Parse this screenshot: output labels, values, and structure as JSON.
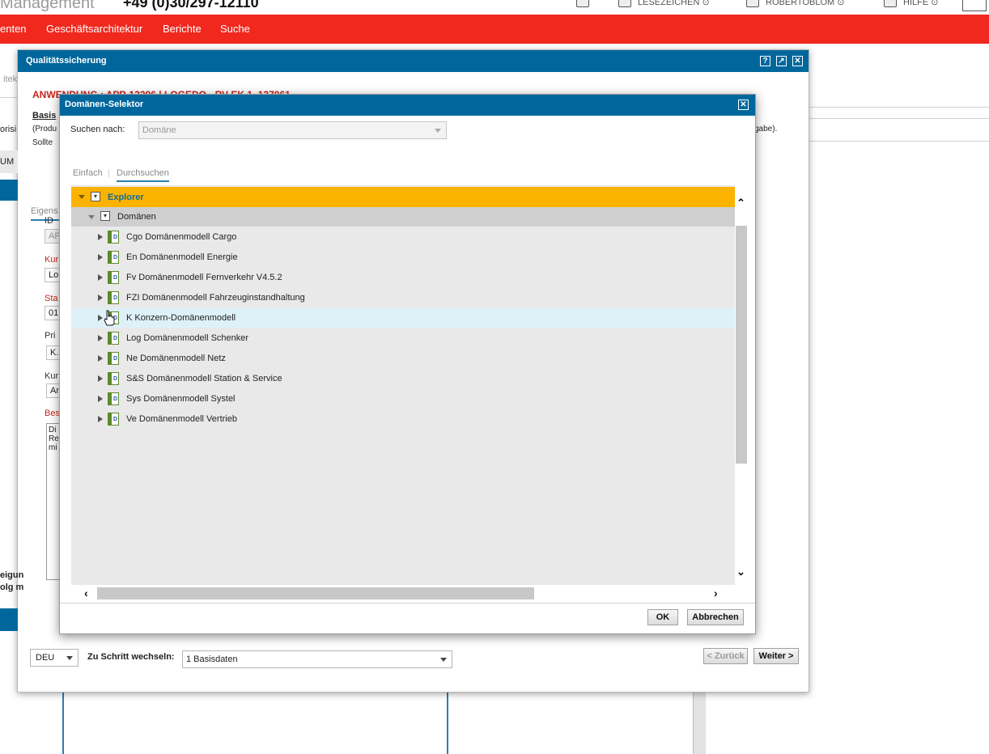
{
  "header": {
    "app_title": "Management",
    "phone": "+49 (0)30/297-12110",
    "links": [
      {
        "label": "LESEZEICHEN ⊙",
        "icon": "bookmark-icon"
      },
      {
        "label": "ROBERTOBLOM ⊙",
        "icon": "user-icon"
      },
      {
        "label": "HILFE ⊙",
        "icon": "help-icon"
      }
    ],
    "home_icon": "home-icon"
  },
  "nav": {
    "items": [
      "enten",
      "Geschäftsarchitektur",
      "Berichte",
      "Suche"
    ]
  },
  "background": {
    "frag_itek": "itek",
    "frag_gabe": "gabe)."
  },
  "qs_dialog": {
    "title": "Qualitätssicherung",
    "header_buttons": [
      "?",
      "↗",
      "✕"
    ],
    "anwendung": "ANWENDUNG : APP-13296 | LOGEDO - RV EK 1, 137061",
    "basis": "Basis",
    "produ": "(Produ",
    "sollte": "Sollte",
    "left_frag_orisi": "orisi",
    "left_frag_um": "UM",
    "left_frag_eigun": "eigun",
    "left_frag_olgm": "olg m",
    "tab_eigens": "Eigens",
    "fields": [
      {
        "label": "ID",
        "value": "AP",
        "red": false,
        "grey": true
      },
      {
        "label": "Kur",
        "value": "Lo",
        "red": true,
        "grey": false
      },
      {
        "label": "Sta",
        "value": "01",
        "red": true,
        "grey": false
      },
      {
        "label": "Pri",
        "value": "K.",
        "red": false,
        "grey": false
      },
      {
        "label": "Kur",
        "value": "An",
        "red": false,
        "grey": false
      }
    ],
    "bes_label": "Bes",
    "textarea_lines": [
      "Di",
      "Re",
      "mi"
    ],
    "footer": {
      "lang": "DEU",
      "step_label": "Zu Schritt wechseln:",
      "step_value": "1 Basisdaten",
      "back": "< Zurück",
      "next": "Weiter >"
    }
  },
  "domain_selector": {
    "title": "Domänen-Selektor",
    "search_label": "Suchen nach:",
    "search_value": "Domäne",
    "tabs": [
      "Einfach",
      "Durchsuchen"
    ],
    "tab_sep": "|",
    "tree_root": "Explorer",
    "tree_group": "Domänen",
    "items": [
      "Cgo Domänenmodell Cargo",
      "En Domänenmodell Energie",
      "Fv Domänenmodell Fernverkehr V4.5.2",
      "FZI Domänenmodell Fahrzeuginstandhaltung",
      "K Konzern-Domänenmodell",
      "Log Domänenmodell Schenker",
      "Ne Domänenmodell Netz",
      "S&S Domänenmodell Station & Service",
      "Sys Domänenmodell Systel",
      "Ve Domänenmodell Vertrieb"
    ],
    "hovered_item": 4,
    "ok": "OK",
    "cancel": "Abbrechen"
  },
  "colors": {
    "brand_red": "#f0281e",
    "dialog_header": "#00679d",
    "explorer_row": "#fbb300",
    "hover_row": "#dff1f8"
  }
}
